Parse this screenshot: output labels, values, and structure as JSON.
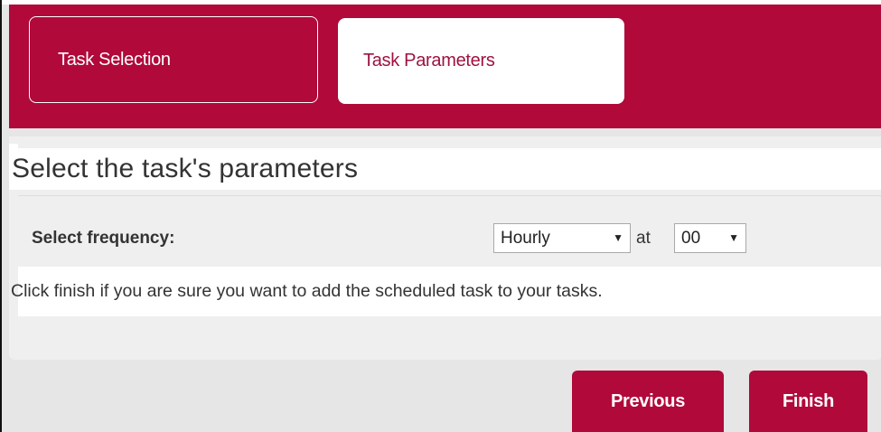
{
  "tabs": [
    {
      "label": "Task Selection",
      "active": false
    },
    {
      "label": "Task Parameters",
      "active": true
    }
  ],
  "main": {
    "title": "Select the task's parameters",
    "frequency": {
      "label": "Select frequency:",
      "selected": "Hourly",
      "at_label": "at",
      "minute_selected": "00"
    },
    "info": "Click finish if you are sure you want to add the scheduled task to your tasks."
  },
  "buttons": {
    "previous": "Previous",
    "finish": "Finish"
  },
  "colors": {
    "brand": "#b0093a",
    "active_tab_text": "#9e1240",
    "panel_bg": "#efefef",
    "page_bg": "#e6e6e6"
  },
  "icons": {
    "dropdown": "triangle-down"
  }
}
